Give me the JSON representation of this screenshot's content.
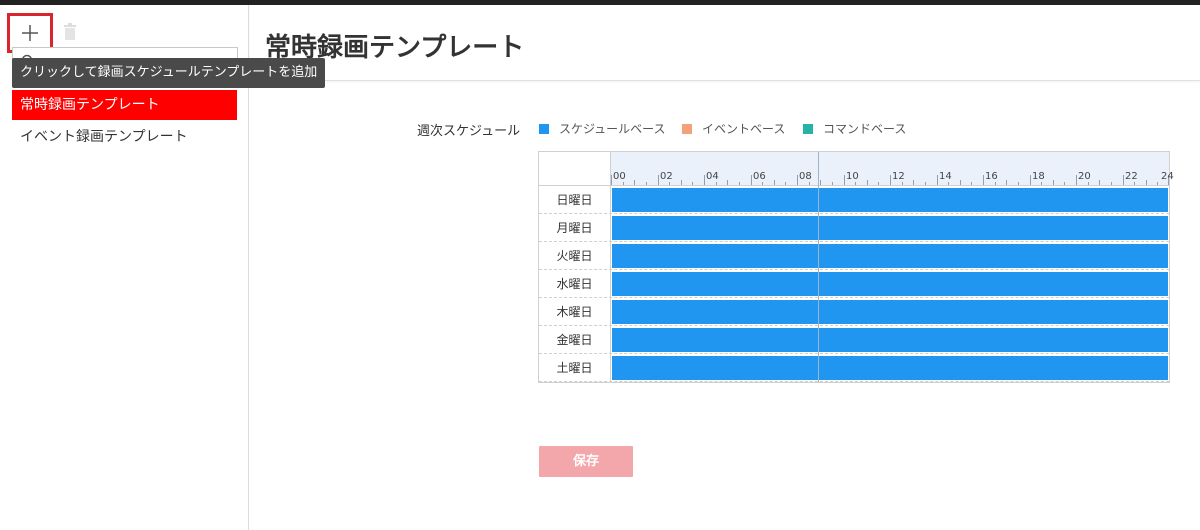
{
  "sidebar": {
    "add_tooltip": "クリックして録画スケジュールテンプレートを追加",
    "templates": [
      {
        "label": "常時録画テンプレート",
        "active": true
      },
      {
        "label": "イベント録画テンプレート",
        "active": false
      }
    ]
  },
  "main": {
    "title": "常時録画テンプレート",
    "schedule_label": "週次スケジュール",
    "legend": [
      {
        "label": "スケジュールベース",
        "color": "#2196f0"
      },
      {
        "label": "イベントベース",
        "color": "#f4a07a"
      },
      {
        "label": "コマンドベース",
        "color": "#26b3a5"
      }
    ],
    "hours": [
      "00",
      "02",
      "04",
      "06",
      "08",
      "10",
      "12",
      "14",
      "16",
      "18",
      "20",
      "22",
      "24"
    ],
    "days": [
      {
        "label": "日曜日",
        "start": 0,
        "end": 24,
        "type": "スケジュールベース"
      },
      {
        "label": "月曜日",
        "start": 0,
        "end": 24,
        "type": "スケジュールベース"
      },
      {
        "label": "火曜日",
        "start": 0,
        "end": 24,
        "type": "スケジュールベース"
      },
      {
        "label": "水曜日",
        "start": 0,
        "end": 24,
        "type": "スケジュールベース"
      },
      {
        "label": "木曜日",
        "start": 0,
        "end": 24,
        "type": "スケジュールベース"
      },
      {
        "label": "金曜日",
        "start": 0,
        "end": 24,
        "type": "スケジュールベース"
      },
      {
        "label": "土曜日",
        "start": 0,
        "end": 24,
        "type": "スケジュールベース"
      }
    ],
    "save_label": "保存"
  }
}
